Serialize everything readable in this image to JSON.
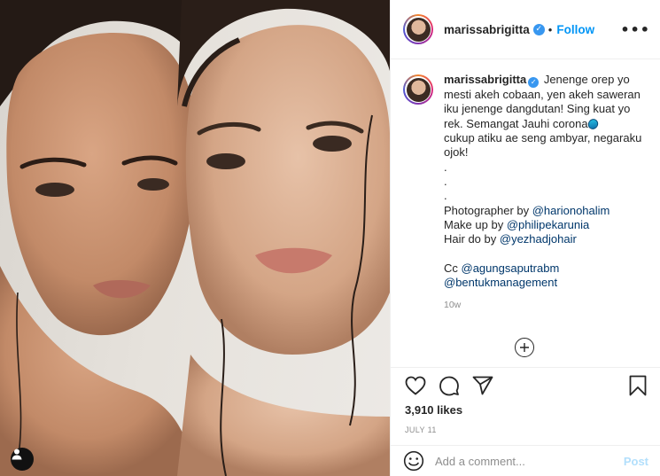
{
  "post": {
    "username": "marissabrigitta",
    "follow_label": "Follow",
    "more_label": "•••"
  },
  "caption": {
    "username": "marissabrigitta",
    "lines": [
      "Jenenge orep yo",
      "mesti akeh cobaan, yen akeh saweran",
      "iku jenenge dangdutan! Sing kuat yo",
      "rek. Semangat Jauhi corona",
      "cukup atiku ae seng ambyar, negaraku",
      "ojok!",
      ".",
      ".",
      "."
    ],
    "credits": [
      {
        "prefix": "Photographer by ",
        "mention": "@harionohalim"
      },
      {
        "prefix": "Make up by ",
        "mention": "@philipekarunia"
      },
      {
        "prefix": "Hair do by ",
        "mention": "@yezhadjohair"
      }
    ],
    "cc_prefix": "Cc ",
    "cc_mentions": [
      "@agungsaputrabm",
      "@bentukmanagement"
    ],
    "time_ago": "10w"
  },
  "engagement": {
    "likes": "3,910 likes",
    "date": "JULY 11"
  },
  "comment": {
    "placeholder": "Add a comment...",
    "post_label": "Post"
  },
  "icons": {
    "verified": "verified-badge-icon",
    "like": "heart-icon",
    "comment": "comment-bubble-icon",
    "share": "paper-plane-icon",
    "save": "bookmark-icon",
    "emoji": "smiley-icon",
    "load_more": "plus-circle-icon",
    "tag": "user-tag-icon",
    "caption_emoji": "pill-emoji"
  },
  "colors": {
    "accent": "#0095f6",
    "verified": "#3897f0",
    "mention": "#00376b",
    "muted": "#8e8e8e",
    "post_disabled": "#b2dffc"
  }
}
